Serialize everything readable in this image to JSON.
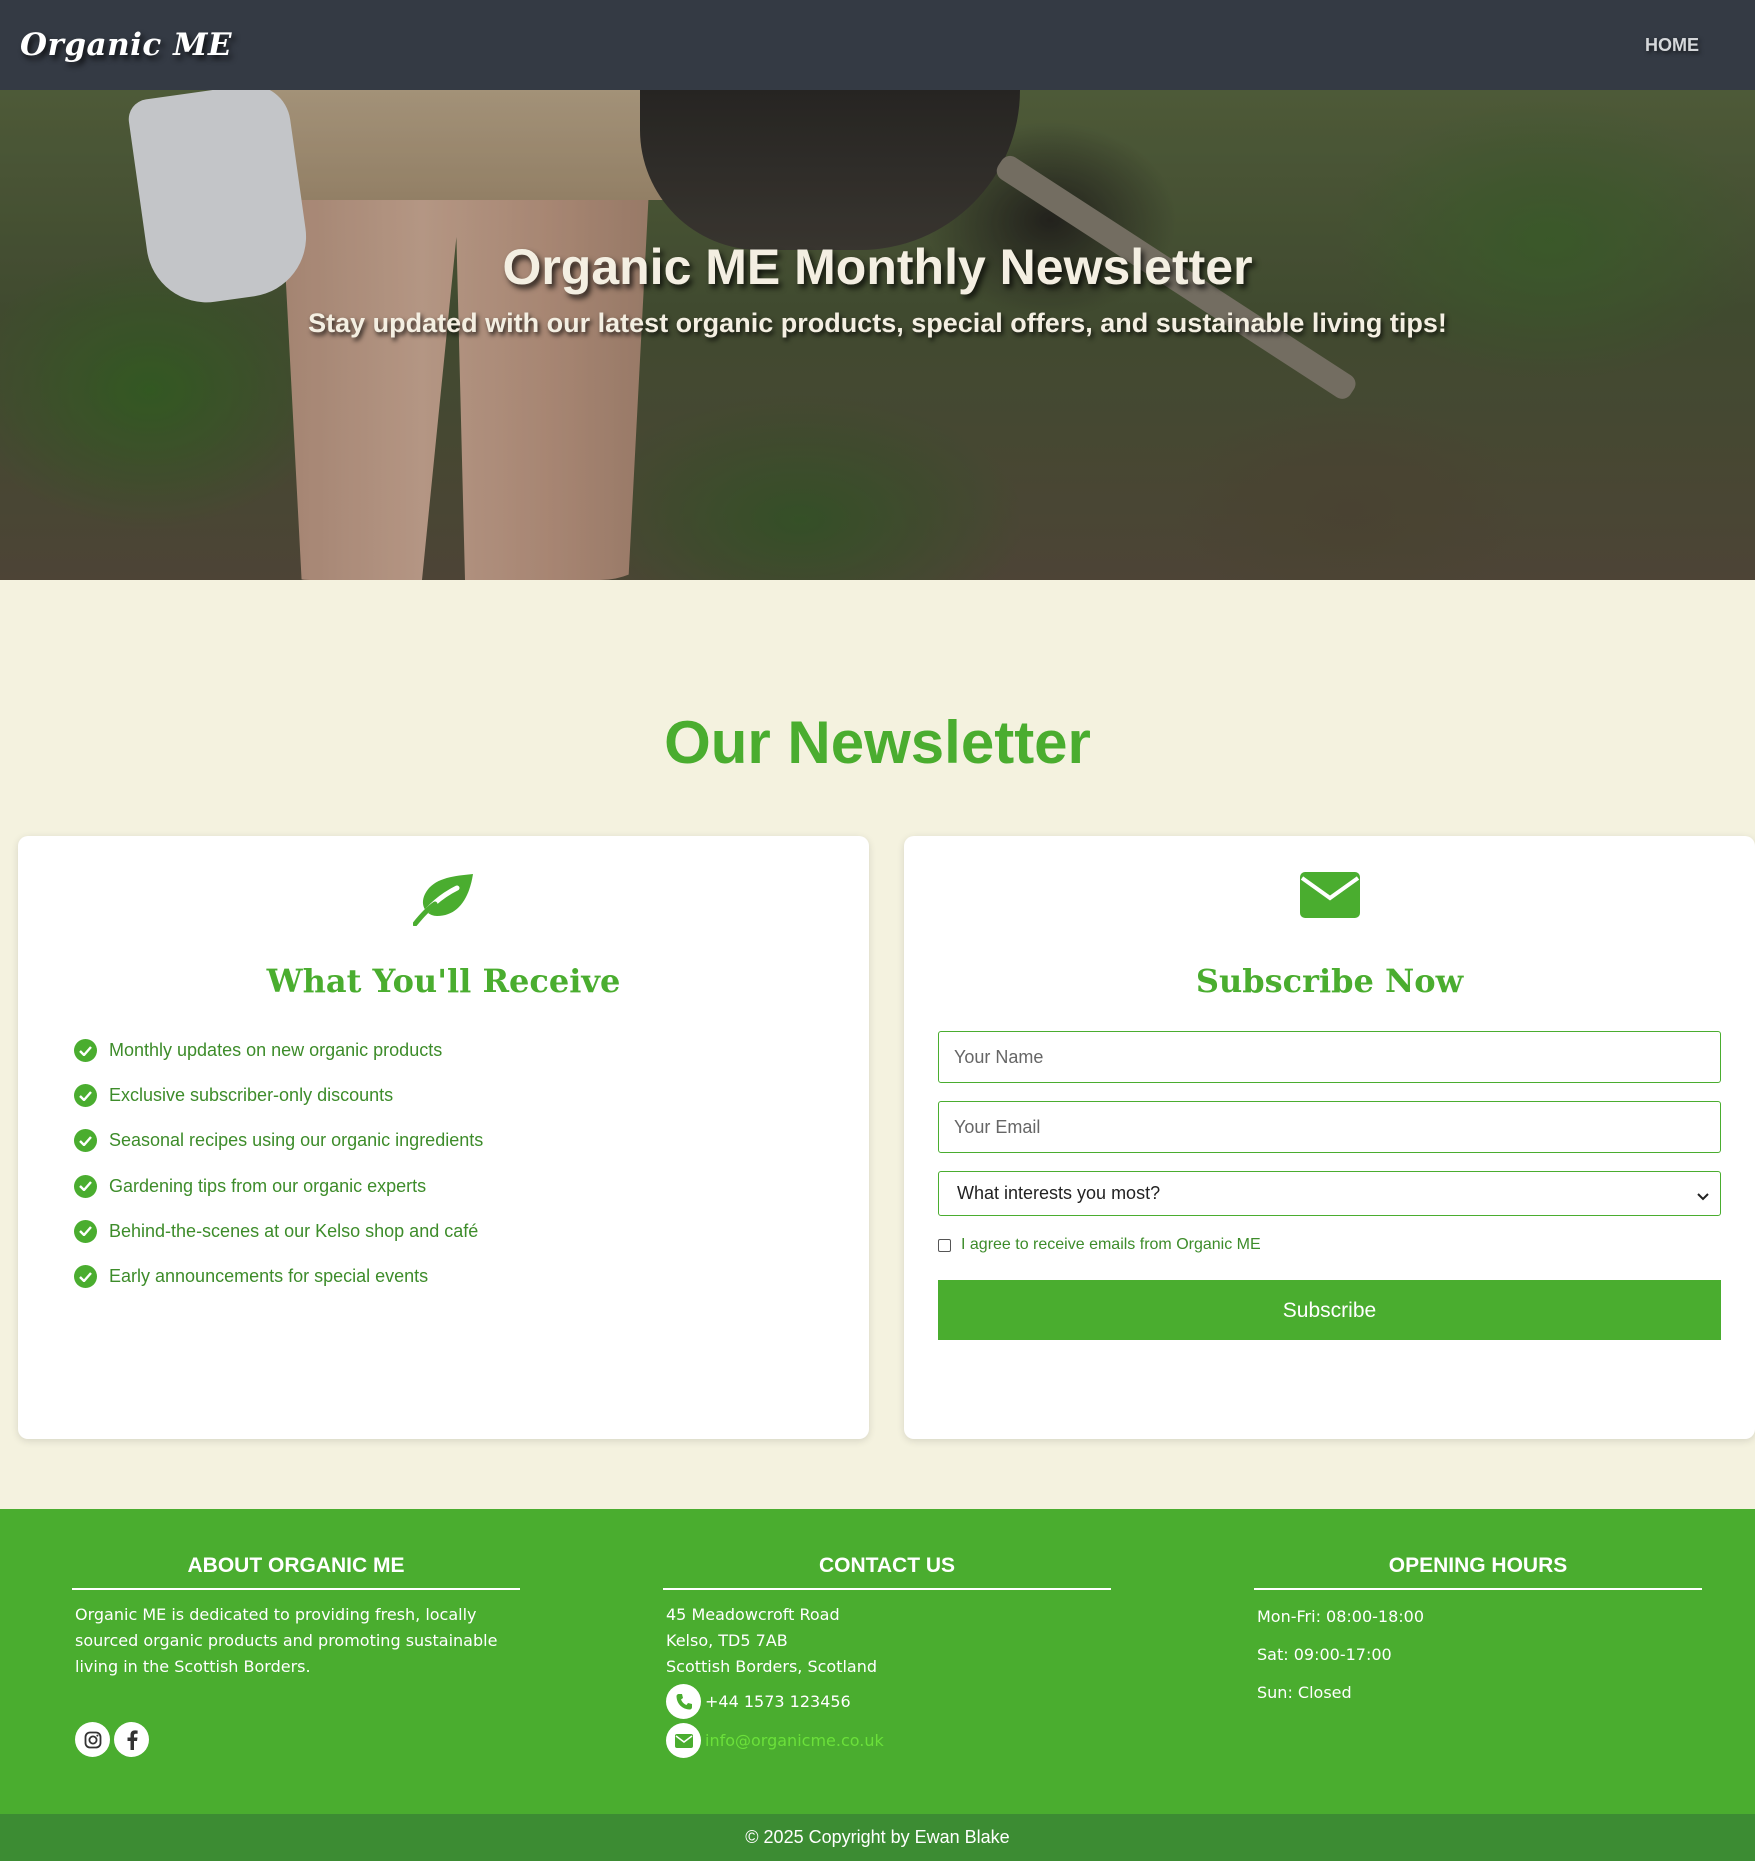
{
  "nav": {
    "brand": "Organic ME",
    "home": "HOME"
  },
  "hero": {
    "title": "Organic ME Monthly Newsletter",
    "subtitle": "Stay updated with our latest organic products, special offers, and sustainable living tips!"
  },
  "section": {
    "title": "Our Newsletter"
  },
  "receive": {
    "icon": "leaf-icon",
    "title": "What You'll Receive",
    "items": [
      "Monthly updates on new organic products",
      "Exclusive subscriber-only discounts",
      "Seasonal recipes using our organic ingredients",
      "Gardening tips from our organic experts",
      "Behind-the-scenes at our Kelso shop and café",
      "Early announcements for special events"
    ]
  },
  "subscribe": {
    "icon": "envelope-icon",
    "title": "Subscribe Now",
    "name_placeholder": "Your Name",
    "email_placeholder": "Your Email",
    "interest_selected": "What interests you most?",
    "agree_label": "I agree to receive emails from Organic ME",
    "button": "Subscribe"
  },
  "footer": {
    "about": {
      "title": "ABOUT ORGANIC ME",
      "text": "Organic ME is dedicated to providing fresh, locally sourced organic products and promoting sustainable living in the Scottish Borders.",
      "social": [
        "instagram-icon",
        "facebook-icon"
      ]
    },
    "contact": {
      "title": "CONTACT US",
      "address": [
        "45 Meadowcroft Road",
        "Kelso, TD5 7AB",
        "Scottish Borders, Scotland"
      ],
      "phone": "+44 1573 123456",
      "email": "info@organicme.co.uk"
    },
    "hours": {
      "title": "OPENING HOURS",
      "lines": [
        "Mon-Fri: 08:00-18:00",
        "Sat: 09:00-17:00",
        "Sun: Closed"
      ]
    },
    "copyright": "© 2025 Copyright by Ewan Blake"
  },
  "colors": {
    "accent": "#4aad2f",
    "nav": "#343a44",
    "background": "#f4f2df",
    "copyright_bar": "#3c8c33"
  }
}
